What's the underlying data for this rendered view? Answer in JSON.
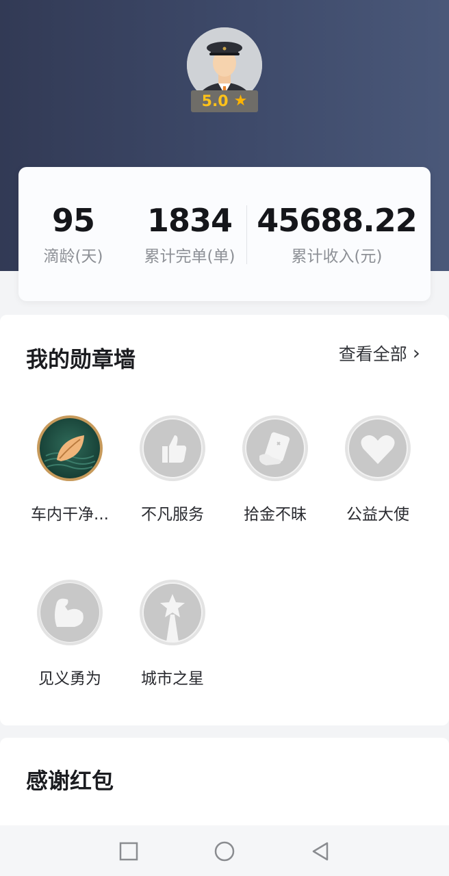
{
  "profile": {
    "rating": "5.0",
    "star_icon": "star-icon"
  },
  "stats": {
    "days_value": "95",
    "days_label": "滴龄(天)",
    "orders_value": "1834",
    "orders_label": "累计完单(单)",
    "income_value": "45688.22",
    "income_label": "累计收入(元)"
  },
  "medals": {
    "title": "我的勋章墙",
    "view_all": "查看全部",
    "items": [
      {
        "name": "车内干净...",
        "icon": "leaf-icon",
        "active": true
      },
      {
        "name": "不凡服务",
        "icon": "thumbs-up-icon",
        "active": false
      },
      {
        "name": "拾金不昧",
        "icon": "wallet-icon",
        "active": false
      },
      {
        "name": "公益大使",
        "icon": "heart-icon",
        "active": false
      },
      {
        "name": "见义勇为",
        "icon": "arm-icon",
        "active": false
      },
      {
        "name": "城市之星",
        "icon": "star-icon",
        "active": false
      }
    ]
  },
  "thanks": {
    "title": "感谢红包"
  },
  "colors": {
    "header_bg": "#3e4a6a",
    "rating_text": "#ffc21a",
    "active_medal": "#1f4a3f"
  }
}
